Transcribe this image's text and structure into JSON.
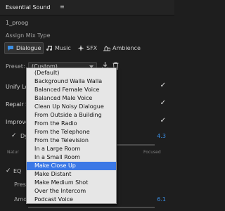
{
  "panel": {
    "title": "Essential Sound",
    "menu_icon": "≡"
  },
  "clip_name": "1_proog",
  "assign_label": "Assign Mix Type",
  "tabs": [
    {
      "label": "Dialogue",
      "icon": "speech-bubble-icon"
    },
    {
      "label": "Music",
      "icon": "music-note-icon"
    },
    {
      "label": "SFX",
      "icon": "sparkle-icon"
    },
    {
      "label": "Ambience",
      "icon": "ambience-icon"
    }
  ],
  "preset": {
    "label": "Preset:",
    "value": "(Custom)"
  },
  "sections": {
    "unify": "Unify Lo",
    "repair": "Repair S",
    "improve": "Improve",
    "dynamics": "Dy",
    "dynamics_value": "4.3",
    "natural": "Natur",
    "focused": "Focused",
    "eq": "EQ",
    "eq_preset": "Preset",
    "amount": "Amou",
    "amount_value": "6.1"
  },
  "dropdown": {
    "items": [
      "(Default)",
      "Background Walla Walla",
      "Balanced Female Voice",
      "Balanced Male Voice",
      "Clean Up Noisy Dialogue",
      "From Outside a Building",
      "From the Radio",
      "From the Telephone",
      "From the Television",
      "In a Large Room",
      "In a Small Room",
      "Make Close Up",
      "Make Distant",
      "Make Medium Shot",
      "Over the Intercom",
      "Podcast Voice"
    ],
    "selected": "Make Close Up"
  },
  "colors": {
    "accent": "#3b78e6",
    "value_blue": "#3b8fe5"
  }
}
